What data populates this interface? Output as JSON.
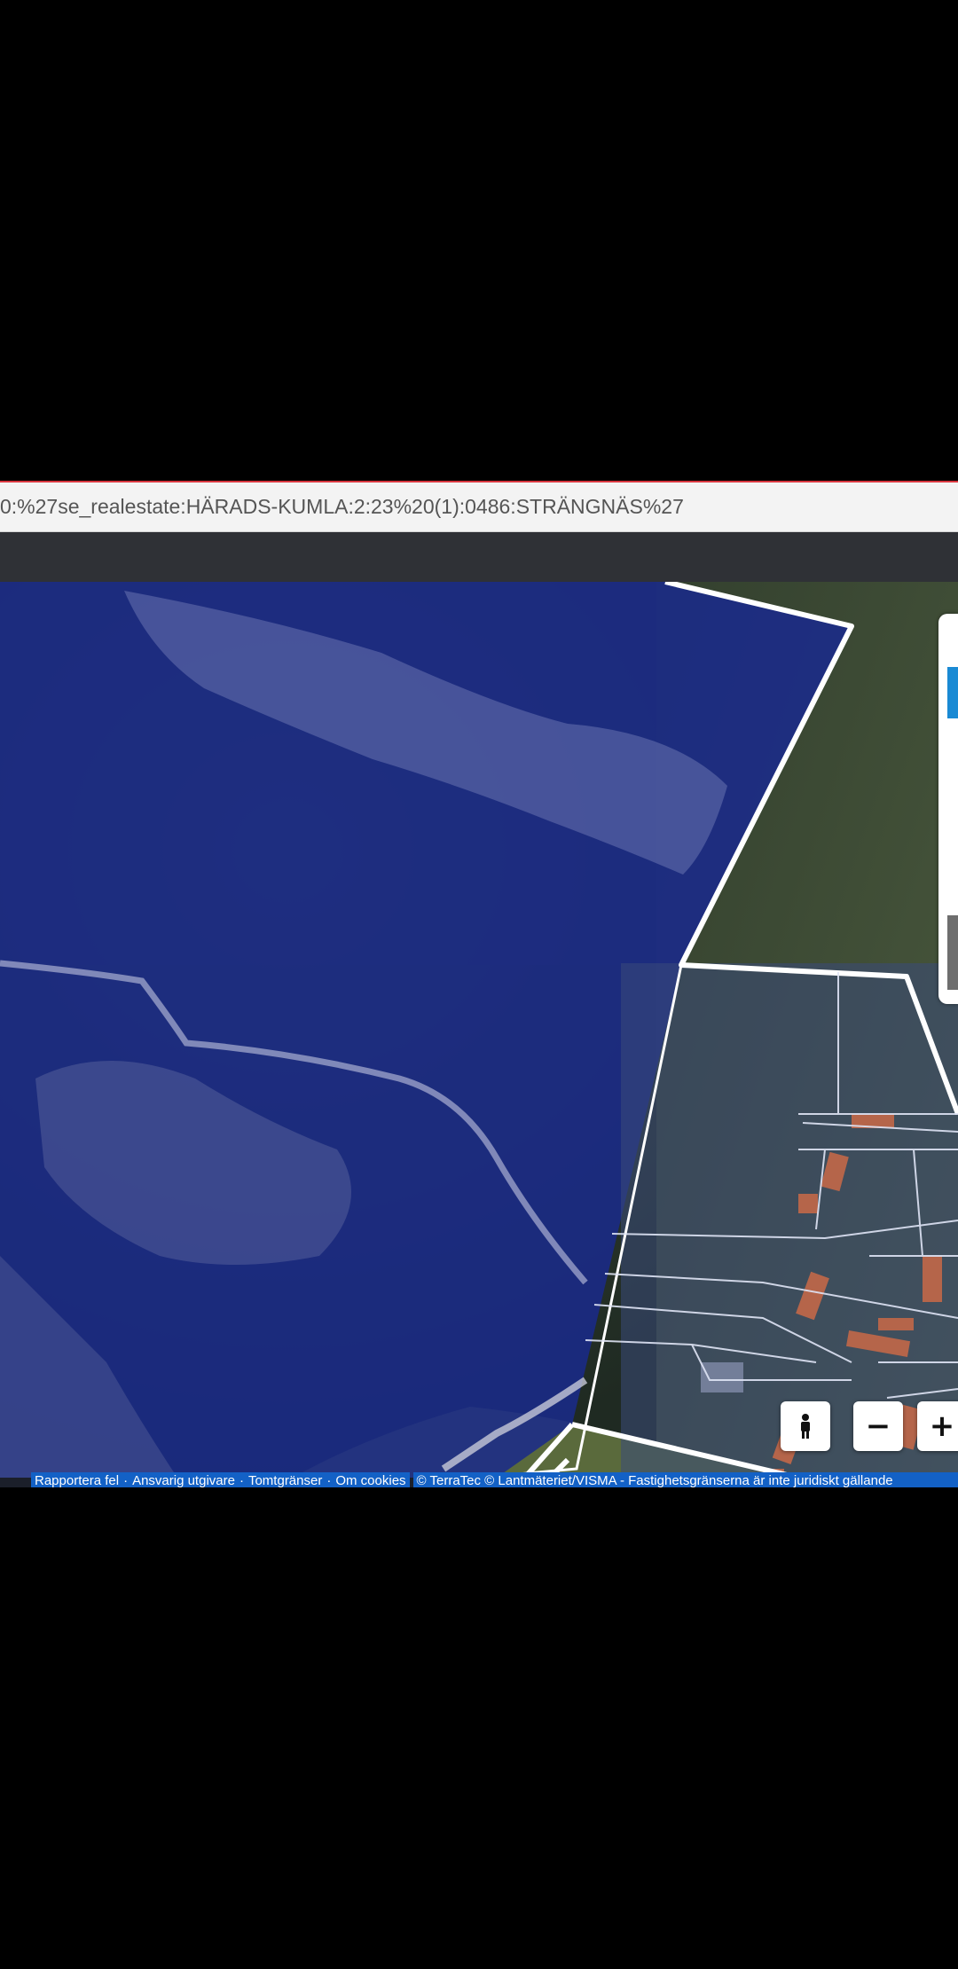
{
  "address_bar": {
    "url_text": "0:%27se_realestate:HÄRADS-KUMLA:2:23%20(1):0486:STRÄNGNÄS%27"
  },
  "map_controls": {
    "streetview_icon": "person-icon",
    "zoom_out_label": "−",
    "zoom_in_label": "+"
  },
  "attribution": {
    "links": [
      "Rapportera fel",
      "Ansvarig utgivare",
      "Tomtgränser",
      "Om cookies"
    ],
    "separator": "·",
    "copyright": "© TerraTec © Lantmäteriet/VISMA - Fastighetsgränserna är inte juridiskt gällande"
  },
  "colors": {
    "selection_overlay": "#1a2a8a",
    "boundary_line": "#ffffff",
    "attribution_bg": "#1361c6",
    "panel_accent": "#1a8ad4"
  }
}
